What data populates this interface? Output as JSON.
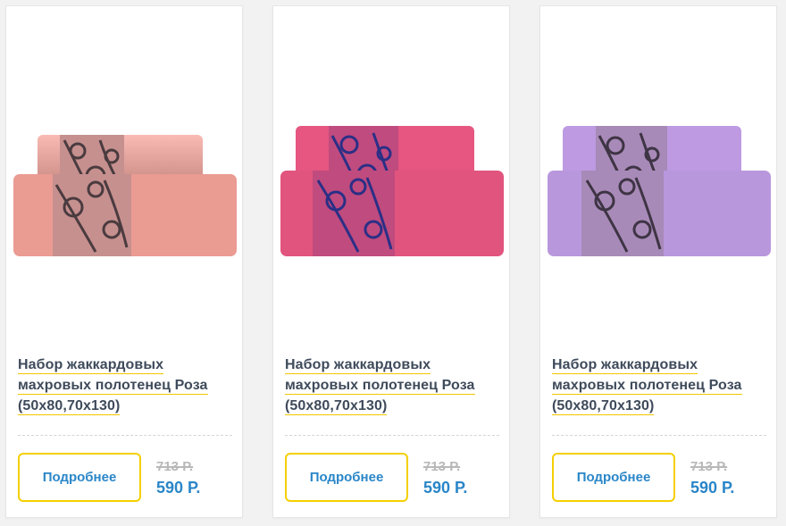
{
  "products": [
    {
      "title": "Набор жаккардовых махровых полотенец Роза (50х80,70х130)",
      "title_lines": [
        "Набор жаккардовых",
        "махровых полотенец Роза",
        "(50х80,70х130)"
      ],
      "details_label": "Подробнее",
      "old_price": "713 Р.",
      "price": "590 Р.",
      "towel_color": "#f7a49a",
      "towel_shade": "#e88e85",
      "band_color": "#c6908f",
      "pattern_color": "#4a3b3f"
    },
    {
      "title": "Набор жаккардовых махровых полотенец Роза (50х80,70х130)",
      "title_lines": [
        "Набор жаккардовых",
        "махровых полотенец Роза",
        "(50х80,70х130)"
      ],
      "details_label": "Подробнее",
      "old_price": "713 Р.",
      "price": "590 Р.",
      "towel_color": "#f05a86",
      "towel_shade": "#d9436f",
      "band_color": "#c04b7e",
      "pattern_color": "#2b2f86"
    },
    {
      "title": "Набор жаккардовых махровых полотенец Роза (50х80,70х130)",
      "title_lines": [
        "Набор жаккардовых",
        "махровых полотенец Роза",
        "(50х80,70х130)"
      ],
      "details_label": "Подробнее",
      "old_price": "713 Р.",
      "price": "590 Р.",
      "towel_color": "#c5a1eb",
      "towel_shade": "#a981d6",
      "band_color": "#a88ab8",
      "pattern_color": "#3e3444"
    }
  ],
  "colors": {
    "accent_yellow": "#f5cf00",
    "price_blue": "#2a86c8",
    "title_dark": "#3f4b5b",
    "old_price_gray": "#b8b8b8"
  },
  "icons": {
    "product_image": "towel-set-image"
  }
}
